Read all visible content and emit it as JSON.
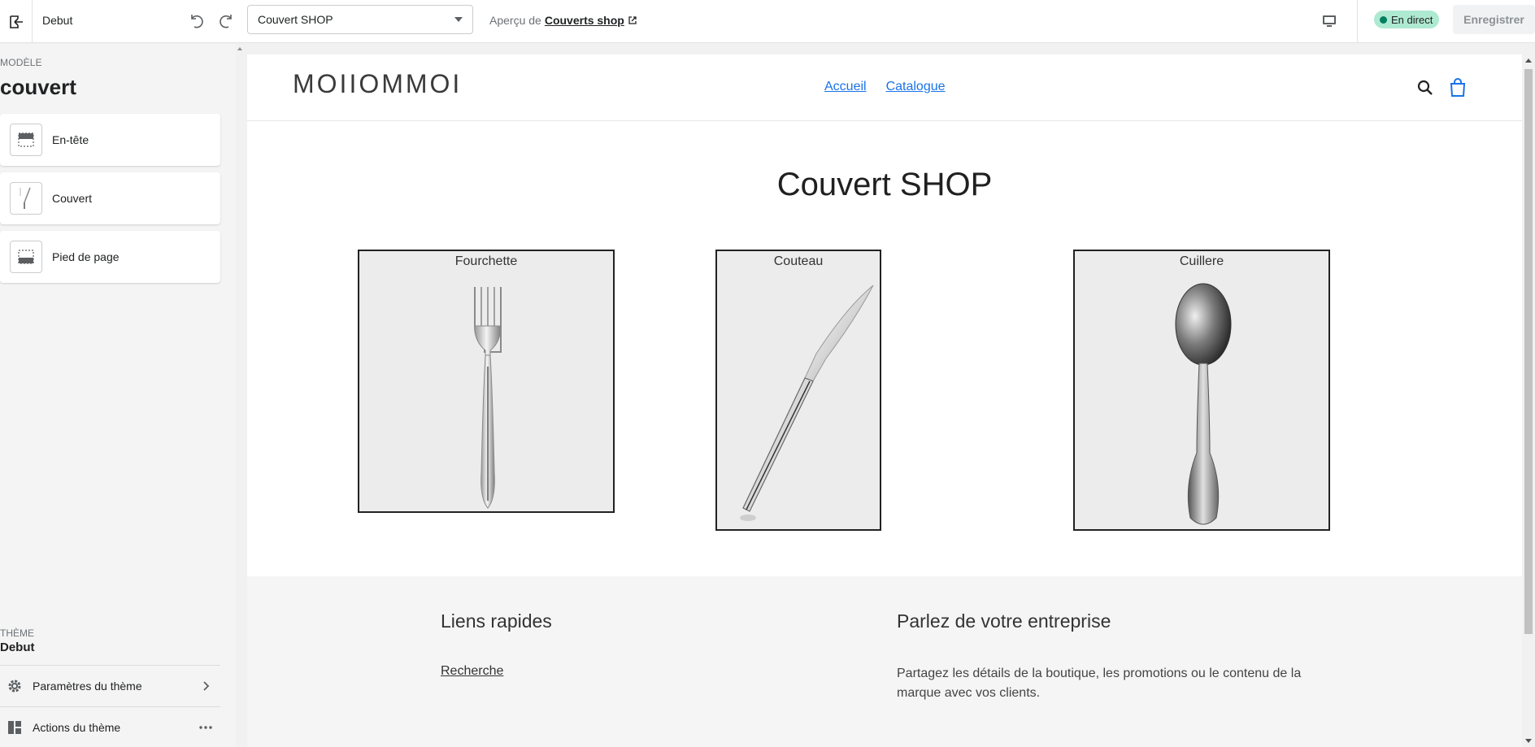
{
  "topbar": {
    "theme_name": "Debut",
    "page_select_value": "Couvert SHOP",
    "preview_prefix": "Aperçu de",
    "preview_store": "Couverts shop",
    "live_label": "En direct",
    "save_label": "Enregistrer"
  },
  "sidebar": {
    "kicker": "MODÈLE",
    "template_name": "couvert",
    "sections": [
      {
        "label": "En-tête",
        "icon": "header-layout-icon"
      },
      {
        "label": "Couvert",
        "icon": "fork-thumbnail-icon"
      },
      {
        "label": "Pied de page",
        "icon": "footer-layout-icon"
      }
    ],
    "theme_kicker": "THÈME",
    "theme_title": "Debut",
    "rows": [
      {
        "label": "Paramètres du thème",
        "icon": "gear-icon",
        "trail": "chevron-right-icon"
      },
      {
        "label": "Actions du thème",
        "icon": "layout-icon",
        "trail": "more-horizontal-icon"
      }
    ]
  },
  "store": {
    "logo": "MOIIOMMOI",
    "nav": [
      "Accueil",
      "Catalogue"
    ],
    "title": "Couvert SHOP",
    "products": [
      {
        "title": "Fourchette"
      },
      {
        "title": "Couteau"
      },
      {
        "title": "Cuillere"
      }
    ],
    "footer": {
      "links_heading": "Liens rapides",
      "links": [
        "Recherche"
      ],
      "about_heading": "Parlez de votre entreprise",
      "about_text": "Partagez les détails de la boutique, les promotions ou le contenu de la marque avec vos clients."
    }
  },
  "colors": {
    "live_badge": "#aee9d1",
    "live_dot": "#007f5f",
    "nav_link": "#1a73e8",
    "footer_bg": "#f5f5f5"
  }
}
